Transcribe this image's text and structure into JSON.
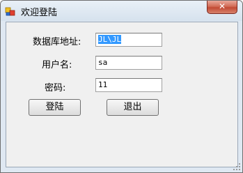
{
  "window": {
    "title": "欢迎登陆",
    "close_label": "✕"
  },
  "form": {
    "db_label": "数据库地址:",
    "db_value": "JL\\JL",
    "user_label": "用户名:",
    "user_value": "sa",
    "password_label": "密码:",
    "password_value": "11"
  },
  "buttons": {
    "login_label": "登陆",
    "exit_label": "退出"
  }
}
